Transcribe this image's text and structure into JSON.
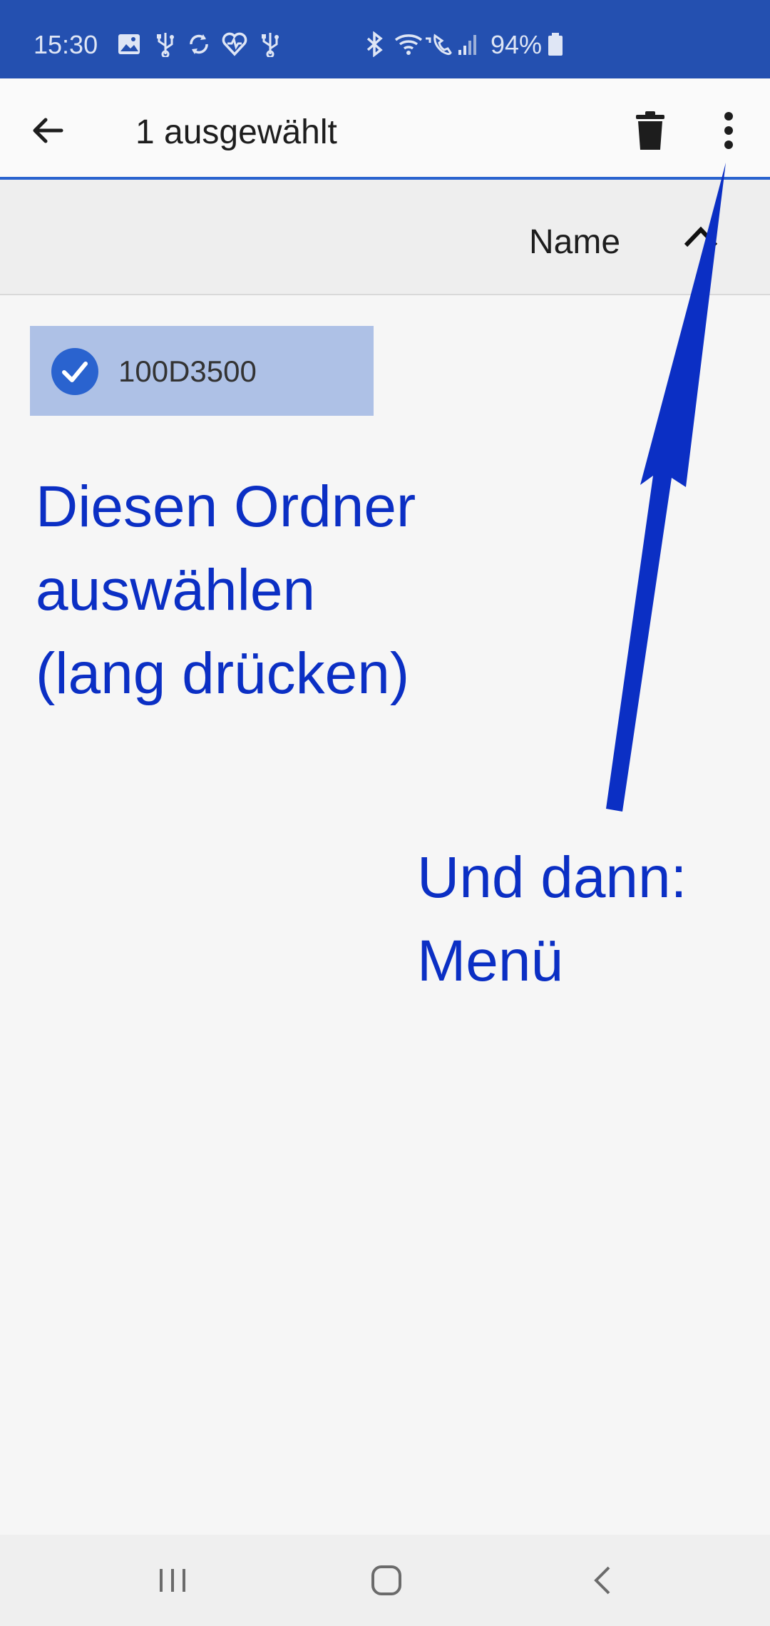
{
  "status_bar": {
    "time": "15:30",
    "battery": "94%",
    "bg_color": "#2450b0",
    "icons": [
      "gallery-icon",
      "usb-icon",
      "sync-icon",
      "health-icon",
      "usb-icon",
      "bluetooth-icon",
      "wifi-calling-icon",
      "signal-icon",
      "battery-icon"
    ]
  },
  "app_bar": {
    "title": "1 ausgewählt",
    "back_icon": "arrow-left-icon",
    "delete_icon": "trash-icon",
    "menu_icon": "more-vertical-icon"
  },
  "sort_bar": {
    "label": "Name",
    "direction_icon": "chevron-up-icon"
  },
  "items": [
    {
      "name": "100D3500",
      "selected": true
    }
  ],
  "annotations": {
    "select_line1": "Diesen Ordner",
    "select_line2": "auswählen",
    "select_line3": "(lang drücken)",
    "menu_line1": "Und dann:",
    "menu_line2": "Menü",
    "color": "#0b2fc4"
  },
  "nav_bar": {
    "icons": [
      "recents-icon",
      "home-icon",
      "back-icon"
    ]
  }
}
